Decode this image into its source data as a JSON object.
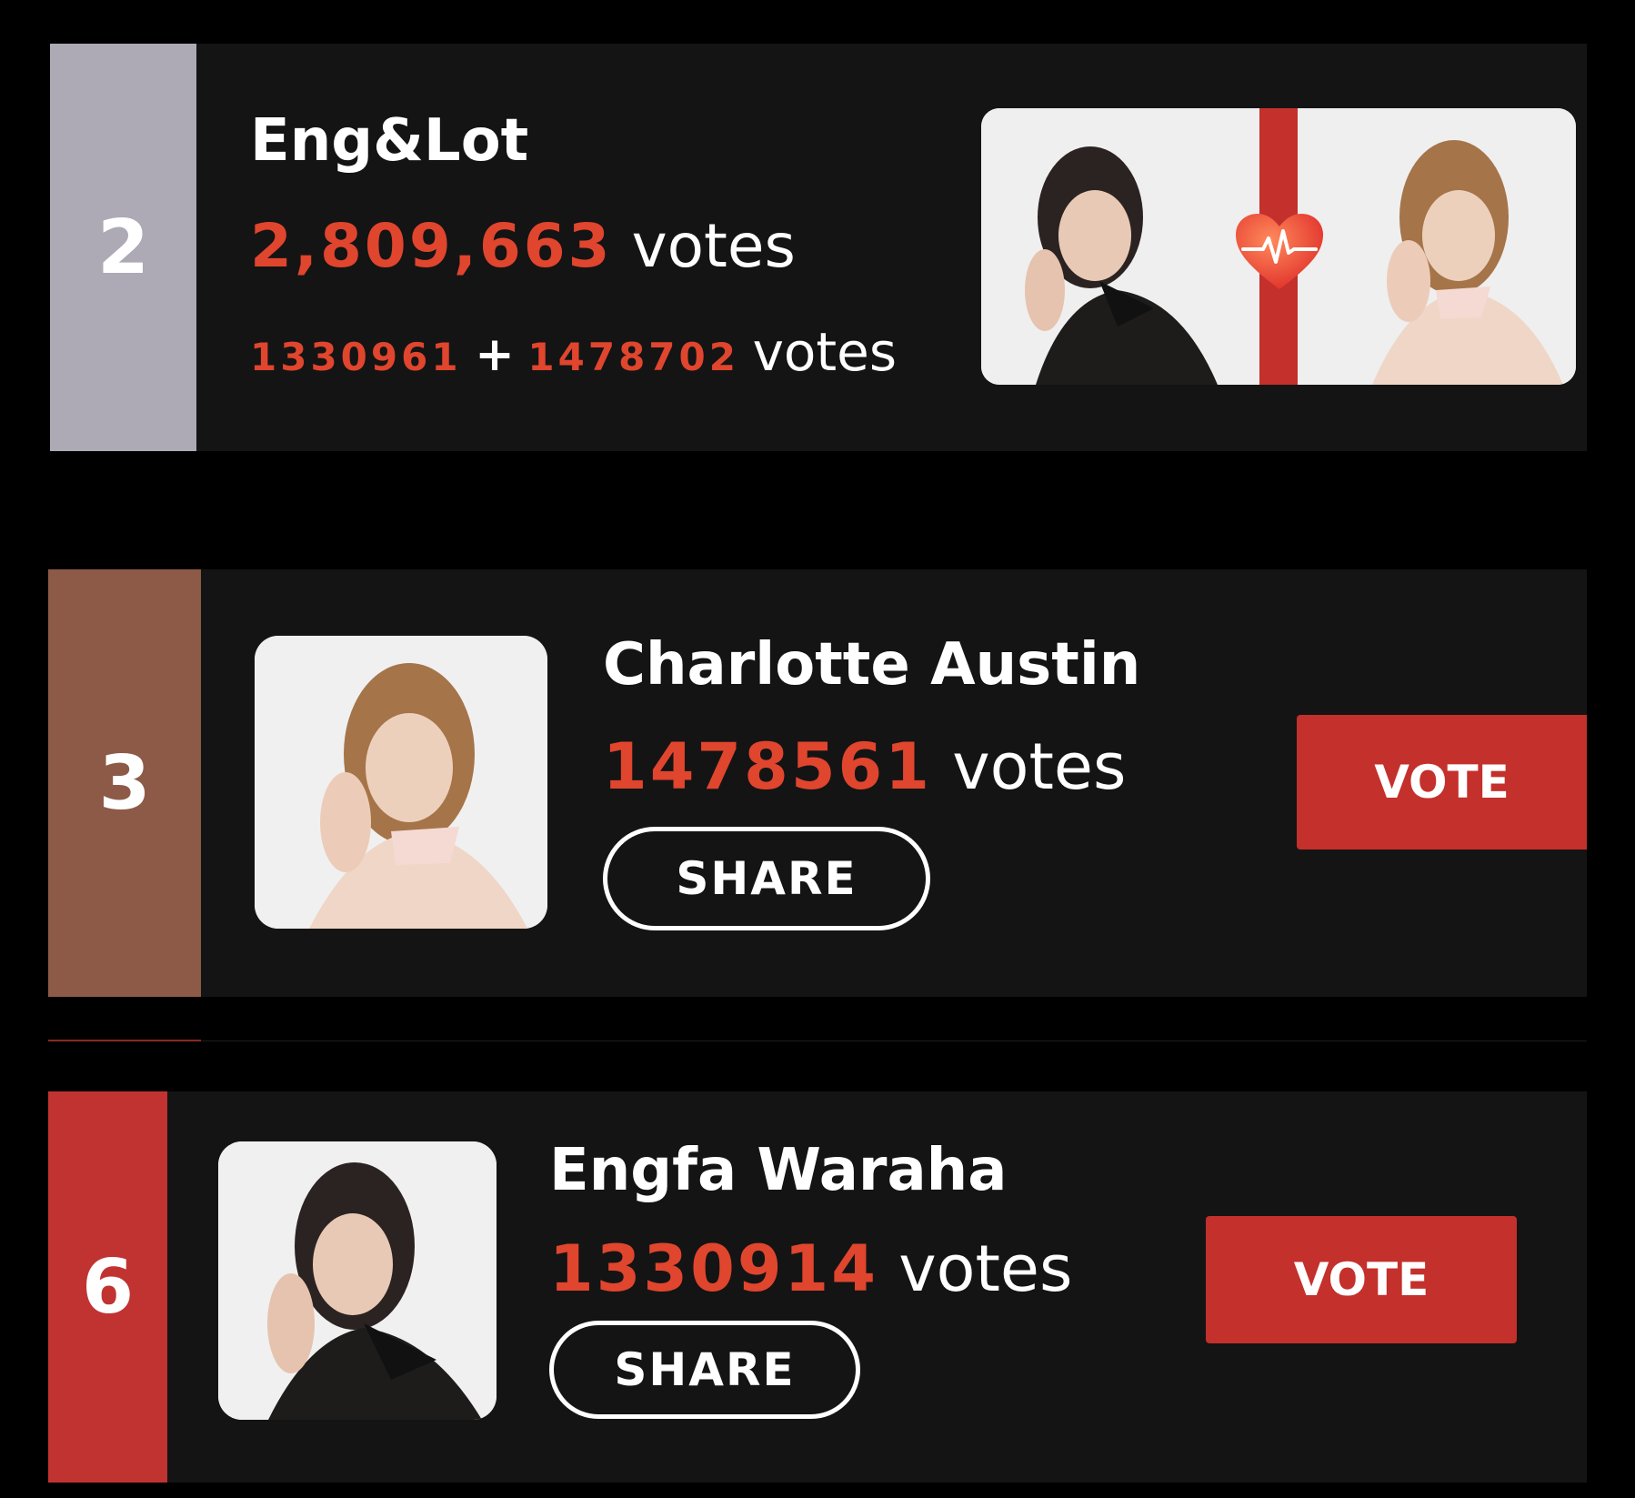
{
  "entries": [
    {
      "rank": "2",
      "name": "Eng&Lot",
      "votes": "2,809,663",
      "votes_word": "votes",
      "breakdown": {
        "a": "1330961",
        "plus": "+",
        "b": "1478702",
        "word": "votes"
      },
      "rank_color": "#ada9b5"
    },
    {
      "rank": "3",
      "name": "Charlotte Austin",
      "votes": "1478561",
      "votes_word": "votes",
      "share_label": "SHARE",
      "vote_label": "VOTE",
      "rank_color": "#8d5a48"
    },
    {
      "rank": "6",
      "name": "Engfa Waraha",
      "votes": "1330914",
      "votes_word": "votes",
      "share_label": "SHARE",
      "vote_label": "VOTE",
      "rank_color": "#c13331"
    }
  ],
  "colors": {
    "vote_number": "#e0452e",
    "vote_button": "#c4302c",
    "card_background": "#141414",
    "page_background": "#000000"
  },
  "icons": {
    "heart": "heart-pulse-icon"
  }
}
